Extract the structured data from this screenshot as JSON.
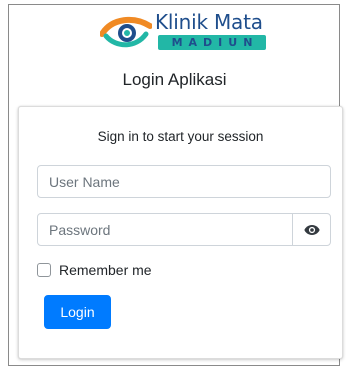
{
  "brand": {
    "name": "Klinik Mata",
    "sub": "MADIUN",
    "colors": {
      "navy": "#1f4e8c",
      "teal": "#22b7a6",
      "orange": "#f08a24"
    }
  },
  "app_title": "Login Aplikasi",
  "form": {
    "message": "Sign in to start your session",
    "username_placeholder": "User Name",
    "username_value": "",
    "password_placeholder": "Password",
    "password_value": "",
    "toggle_icon": "eye-icon",
    "remember_label": "Remember me",
    "remember_checked": false,
    "login_label": "Login"
  },
  "colors": {
    "primary": "#007bff",
    "border": "#ced4da"
  }
}
